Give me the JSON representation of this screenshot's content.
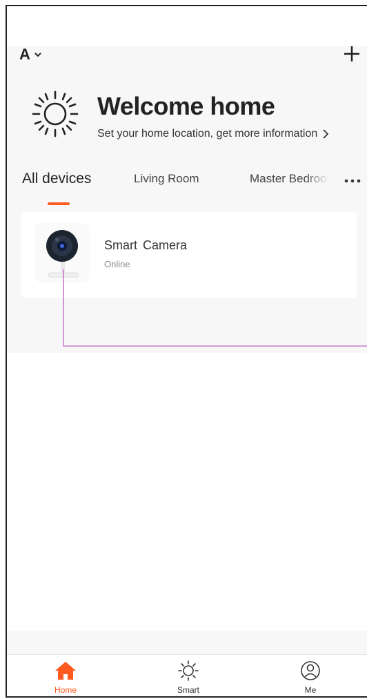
{
  "header": {
    "home_name": "A",
    "add_icon": "plus-icon"
  },
  "welcome": {
    "title": "Welcome home",
    "subtitle": "Set your home location, get more information",
    "icon": "sun-icon"
  },
  "tabs": [
    {
      "label": "All devices",
      "active": true
    },
    {
      "label": "Living Room",
      "active": false
    },
    {
      "label": "Master Bedroom",
      "active": false
    }
  ],
  "devices": [
    {
      "name": "Smart  Camera",
      "status": "Online",
      "icon": "camera-icon"
    }
  ],
  "bottom_nav": [
    {
      "label": "Home",
      "icon": "home-icon",
      "active": true
    },
    {
      "label": "Smart",
      "icon": "sun-icon",
      "active": false
    },
    {
      "label": "Me",
      "icon": "person-icon",
      "active": false
    }
  ],
  "colors": {
    "accent": "#ff5a1f",
    "callout_line": "#c77dc7"
  }
}
